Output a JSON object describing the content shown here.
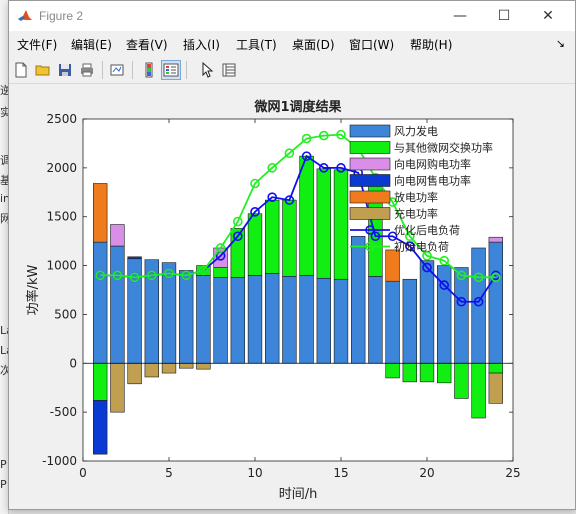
{
  "window": {
    "title": "Figure 2",
    "minimize": "—",
    "maximize": "☐",
    "close": "✕"
  },
  "menu": {
    "items": [
      "文件(F)",
      "编辑(E)",
      "查看(V)",
      "插入(I)",
      "工具(T)",
      "桌面(D)",
      "窗口(W)",
      "帮助(H)"
    ],
    "dock_arrow": "↘"
  },
  "background_fragments": [
    "逆",
    "实",
    "调",
    "基",
    "in",
    "网",
    "La",
    "La",
    "次",
    "P",
    "P"
  ],
  "toolbar": {
    "icons": [
      "new-figure-icon",
      "open-folder-icon",
      "save-icon",
      "print-icon",
      "link-plot-icon",
      "colorbar-icon",
      "legend-icon",
      "pointer-icon",
      "property-inspector-icon"
    ]
  },
  "colors": {
    "wind": "#3d85d8",
    "exchange": "#11ee11",
    "buy": "#d98ee8",
    "sell": "#0a3ad1",
    "discharge": "#f07b1c",
    "charge": "#c0a050",
    "load_after": "#1010ee",
    "load_before": "#22ee22"
  },
  "chart_data": {
    "type": "bar",
    "title": "微网1调度结果",
    "xlabel": "时间/h",
    "ylabel": "功率/kW",
    "xlim": [
      0,
      25
    ],
    "ylim": [
      -1000,
      2500
    ],
    "xticks": [
      0,
      5,
      10,
      15,
      20,
      25
    ],
    "yticks": [
      -1000,
      -500,
      0,
      500,
      1000,
      1500,
      2000,
      2500
    ],
    "grid": false,
    "legend_position": "top-right",
    "x": [
      1,
      2,
      3,
      4,
      5,
      6,
      7,
      8,
      9,
      10,
      11,
      12,
      13,
      14,
      15,
      16,
      17,
      18,
      19,
      20,
      21,
      22,
      23,
      24
    ],
    "series": [
      {
        "name": "风力发电",
        "kind": "bar",
        "color_key": "wind",
        "values": [
          1240,
          1200,
          1070,
          1060,
          1030,
          950,
          900,
          880,
          880,
          900,
          920,
          890,
          900,
          870,
          860,
          1300,
          890,
          840,
          860,
          1050,
          1000,
          980,
          1180,
          1240
        ]
      },
      {
        "name": "与其他微网交换功率",
        "kind": "bar",
        "color_key": "exchange",
        "values": [
          -380,
          0,
          0,
          0,
          0,
          0,
          100,
          100,
          500,
          630,
          750,
          780,
          1220,
          1120,
          1120,
          0,
          1000,
          -150,
          -190,
          -190,
          -200,
          -360,
          -560,
          -100
        ]
      },
      {
        "name": "向电网购电功率",
        "kind": "bar",
        "color_key": "buy",
        "values": [
          0,
          220,
          0,
          0,
          0,
          0,
          0,
          200,
          0,
          0,
          0,
          0,
          0,
          0,
          0,
          0,
          0,
          0,
          0,
          0,
          0,
          0,
          0,
          50
        ]
      },
      {
        "name": "向电网售电功率",
        "kind": "bar",
        "color_key": "sell",
        "values": [
          -550,
          0,
          20,
          0,
          0,
          0,
          0,
          0,
          0,
          0,
          0,
          0,
          0,
          0,
          0,
          0,
          0,
          0,
          0,
          0,
          0,
          0,
          0,
          0
        ]
      },
      {
        "name": "放电功率",
        "kind": "bar",
        "color_key": "discharge",
        "values": [
          600,
          0,
          0,
          0,
          0,
          0,
          0,
          0,
          0,
          0,
          0,
          0,
          0,
          0,
          0,
          0,
          0,
          320,
          0,
          0,
          0,
          0,
          0,
          0
        ]
      },
      {
        "name": "充电功率",
        "kind": "bar",
        "color_key": "charge",
        "values": [
          0,
          -500,
          -210,
          -140,
          -100,
          -50,
          -60,
          0,
          0,
          0,
          0,
          0,
          0,
          0,
          0,
          0,
          0,
          0,
          0,
          0,
          0,
          0,
          0,
          -310
        ]
      },
      {
        "name": "优化后电负荷",
        "kind": "line",
        "color_key": "load_after",
        "values": [
          900,
          900,
          880,
          900,
          920,
          900,
          950,
          1100,
          1300,
          1550,
          1700,
          1670,
          2120,
          2000,
          2000,
          1950,
          1300,
          1300,
          1200,
          980,
          800,
          630,
          630,
          900
        ]
      },
      {
        "name": "初始电负荷",
        "kind": "line",
        "color_key": "load_before",
        "values": [
          900,
          900,
          880,
          900,
          920,
          900,
          950,
          1180,
          1450,
          1840,
          2000,
          2150,
          2300,
          2330,
          2340,
          2200,
          1900,
          1650,
          1300,
          1100,
          1050,
          900,
          880,
          880
        ]
      }
    ]
  }
}
